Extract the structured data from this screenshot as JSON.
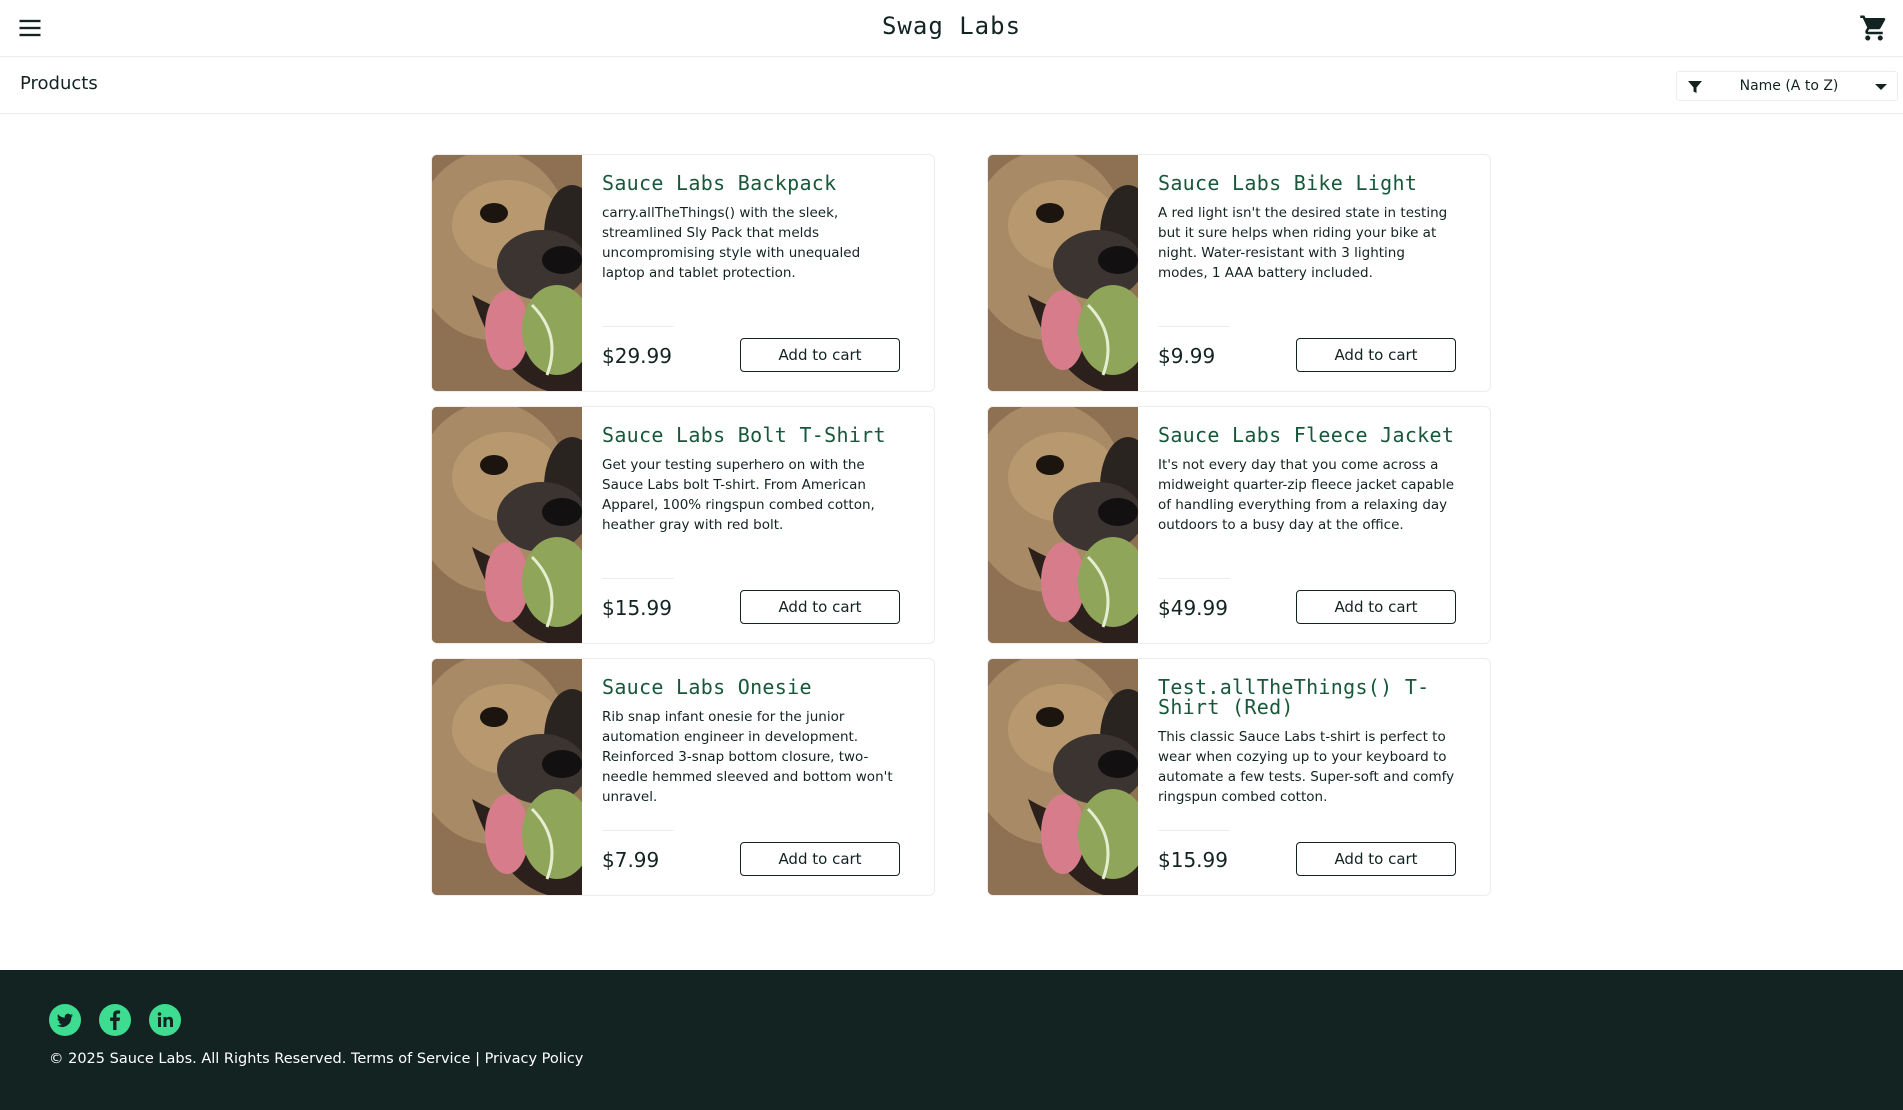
{
  "header": {
    "app_title": "Swag Labs",
    "menu_icon": "hamburger-menu-icon",
    "cart_icon": "shopping-cart-icon"
  },
  "secondary_header": {
    "title": "Products",
    "sort": {
      "selected": "Name (A to Z)",
      "icon": "filter-icon"
    }
  },
  "products": [
    {
      "name": "Sauce Labs Backpack",
      "description": "carry.allTheThings() with the sleek, streamlined Sly Pack that melds uncompromising style with unequaled laptop and tablet protection.",
      "price": "$29.99",
      "button": "Add to cart"
    },
    {
      "name": "Sauce Labs Bike Light",
      "description": "A red light isn't the desired state in testing but it sure helps when riding your bike at night. Water-resistant with 3 lighting modes, 1 AAA battery included.",
      "price": "$9.99",
      "button": "Add to cart"
    },
    {
      "name": "Sauce Labs Bolt T-Shirt",
      "description": "Get your testing superhero on with the Sauce Labs bolt T-shirt. From American Apparel, 100% ringspun combed cotton, heather gray with red bolt.",
      "price": "$15.99",
      "button": "Add to cart"
    },
    {
      "name": "Sauce Labs Fleece Jacket",
      "description": "It's not every day that you come across a midweight quarter-zip fleece jacket capable of handling everything from a relaxing day outdoors to a busy day at the office.",
      "price": "$49.99",
      "button": "Add to cart"
    },
    {
      "name": "Sauce Labs Onesie",
      "description": "Rib snap infant onesie for the junior automation engineer in development. Reinforced 3-snap bottom closure, two-needle hemmed sleeved and bottom won't unravel.",
      "price": "$7.99",
      "button": "Add to cart"
    },
    {
      "name": "Test.allTheThings() T-Shirt (Red)",
      "description": "This classic Sauce Labs t-shirt is perfect to wear when cozying up to your keyboard to automate a few tests. Super-soft and comfy ringspun combed cotton.",
      "price": "$15.99",
      "button": "Add to cart"
    }
  ],
  "footer": {
    "social": [
      "twitter-icon",
      "facebook-icon",
      "linkedin-icon"
    ],
    "copyright": "© 2025 Sauce Labs. All Rights Reserved. Terms of Service | Privacy Policy"
  },
  "colors": {
    "accent": "#3ddc91",
    "product_name": "#18583a",
    "footer_bg": "#132322",
    "text": "#132322"
  }
}
